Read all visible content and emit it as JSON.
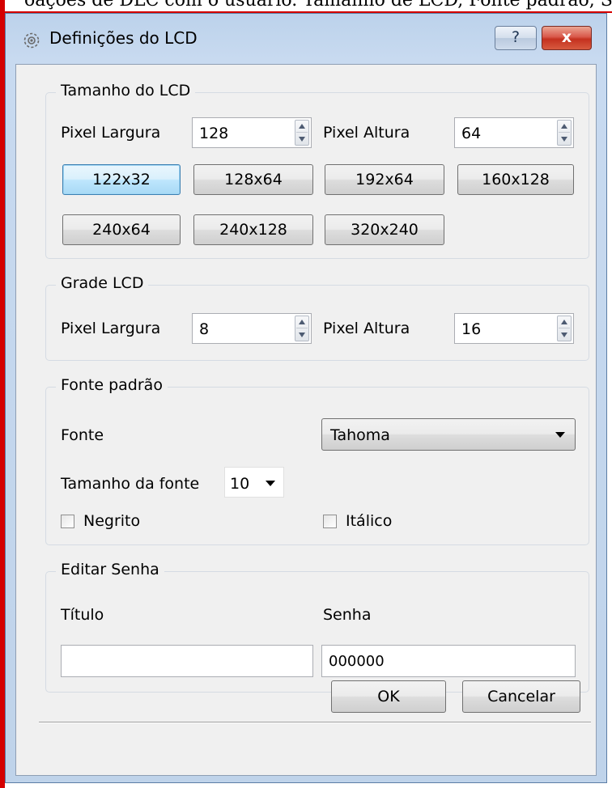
{
  "background_caption": "oações de DLC com o usuário. Tamanho de LCD, Fonte padrão, Senha, gra",
  "window": {
    "title": "Definições do LCD",
    "help_label": "?",
    "close_label": "x",
    "accent_color": "#c4311f"
  },
  "lcd_size": {
    "legend": "Tamanho do LCD",
    "width_label": "Pixel Largura",
    "width_value": "128",
    "height_label": "Pixel Altura",
    "height_value": "64",
    "presets": [
      "122x32",
      "128x64",
      "192x64",
      "160x128",
      "240x64",
      "240x128",
      "320x240"
    ],
    "focused_preset": "122x32"
  },
  "grid": {
    "legend": "Grade LCD",
    "width_label": "Pixel Largura",
    "width_value": "8",
    "height_label": "Pixel Altura",
    "height_value": "16"
  },
  "font": {
    "legend": "Fonte padrão",
    "font_label": "Fonte",
    "font_value": "Tahoma",
    "size_label": "Tamanho da fonte",
    "size_value": "10",
    "bold_label": "Negrito",
    "bold_checked": false,
    "italic_label": "Itálico",
    "italic_checked": false
  },
  "password": {
    "legend": "Editar Senha",
    "title_label": "Título",
    "title_value": "",
    "password_label": "Senha",
    "password_value": "000000"
  },
  "footer": {
    "ok_label": "OK",
    "cancel_label": "Cancelar"
  }
}
